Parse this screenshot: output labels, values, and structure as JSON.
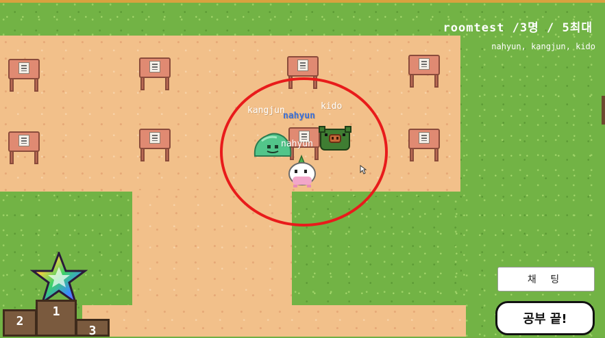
{
  "hud": {
    "room_info": "roomtest /3명 / 5최대",
    "user_list": "nahyun, kangjun, kido"
  },
  "players": [
    {
      "name": "kangjun",
      "character": "green-slime",
      "highlight": false
    },
    {
      "name": "nahyun",
      "character": "white-radish",
      "highlight": true
    },
    {
      "name": "kido",
      "character": "green-boar",
      "highlight": false
    },
    {
      "name": "nahyun",
      "character": "white-radish-label-overlap",
      "highlight": false
    }
  ],
  "buttons": {
    "chat": "채 팅",
    "end_study": "공부 끝!"
  },
  "leaderboard": {
    "icon": "rainbow-star-icon",
    "places": [
      "2",
      "1",
      "3"
    ]
  },
  "colors": {
    "grass": "#72b345",
    "sand": "#f2c08a",
    "highlight_circle": "#e81b1b",
    "name_highlight": "#3a6fd6"
  }
}
